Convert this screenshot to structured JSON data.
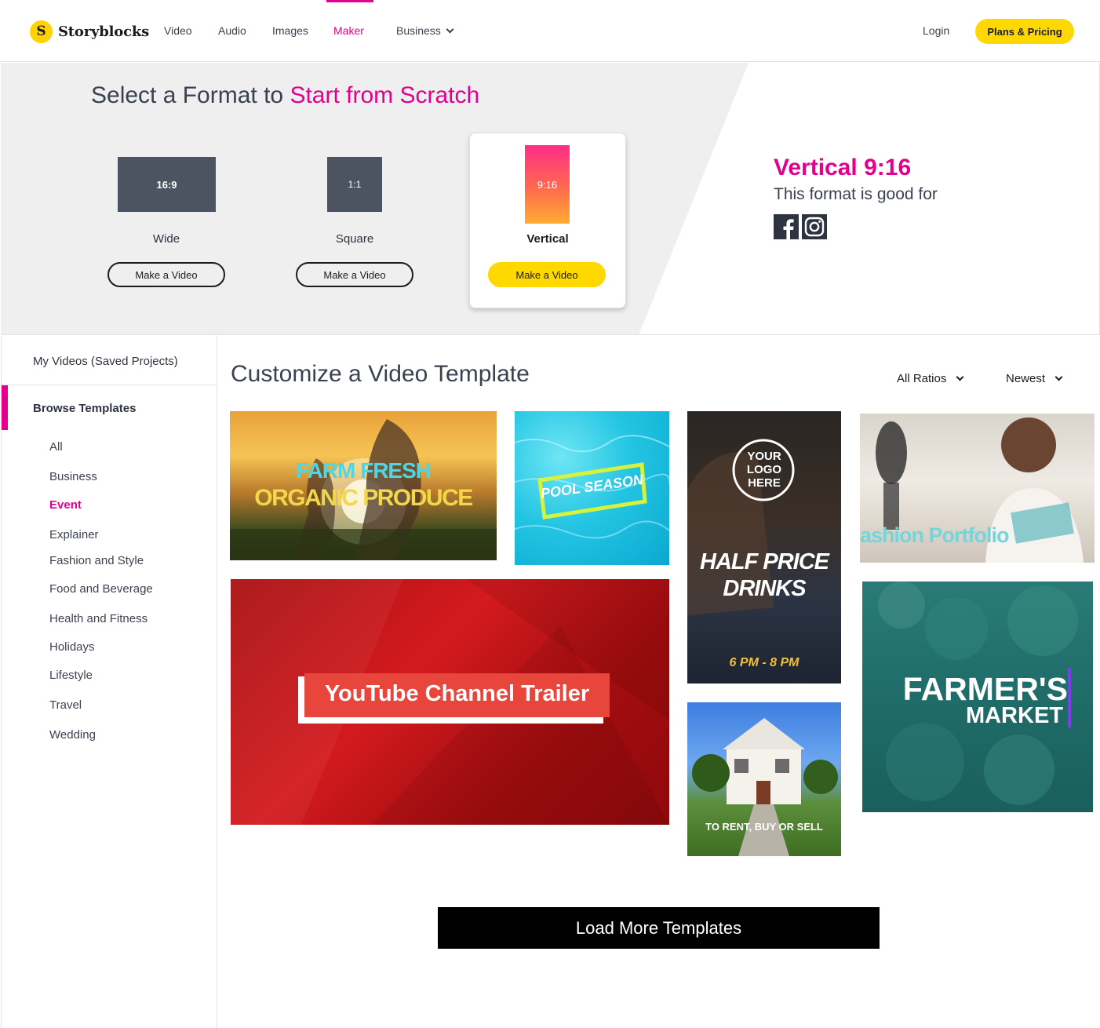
{
  "nav": {
    "logo_mark": "S",
    "logo_text": "Storyblocks",
    "links": [
      "Video",
      "Audio",
      "Images",
      "Maker",
      "Business"
    ],
    "active": "Maker",
    "login": "Login",
    "plans": "Plans & Pricing"
  },
  "hero": {
    "title_plain": "Select a Format to ",
    "title_accent": "Start from Scratch",
    "formats": [
      {
        "shape_label": "16:9",
        "label": "Wide",
        "button": "Make a Video"
      },
      {
        "shape_label": "1:1",
        "label": "Square",
        "button": "Make a Video"
      },
      {
        "shape_label": "9:16",
        "label": "Vertical",
        "button": "Make a Video"
      }
    ],
    "selected": "Vertical",
    "desc_title": "Vertical 9:16",
    "desc_sub": "This format is good for",
    "social_icons": [
      "facebook-icon",
      "instagram-icon"
    ]
  },
  "sidebar": {
    "my_videos": "My Videos (Saved Projects)",
    "browse": "Browse Templates",
    "categories": [
      "All",
      "Business",
      "Event",
      "Explainer",
      "Fashion and Style",
      "Food and Beverage",
      "Health and Fitness",
      "Holidays",
      "Lifestyle",
      "Travel",
      "Wedding"
    ],
    "active_category": "Event"
  },
  "main": {
    "title": "Customize a Video Template",
    "filter_ratio": "All Ratios",
    "filter_sort": "Newest",
    "templates": {
      "farm_line1": "FARM FRESH",
      "farm_line2": "ORGANIC PRODUCE",
      "pool": "POOL SEASON",
      "logo": "YOUR LOGO HERE",
      "drinks_line1": "HALF PRICE",
      "drinks_line2": "DRINKS",
      "drinks_time": "6 PM - 8 PM",
      "fashion": "ashion Portfolio",
      "youtube": "YouTube Channel Trailer",
      "house": "TO RENT, BUY OR SELL",
      "market_line1": "FARMER'S",
      "market_line2": "MARKET"
    },
    "load_more": "Load More Templates"
  },
  "colors": {
    "accent": "#e4008e",
    "yellow": "#ffd800",
    "dark": "#2d3440"
  }
}
